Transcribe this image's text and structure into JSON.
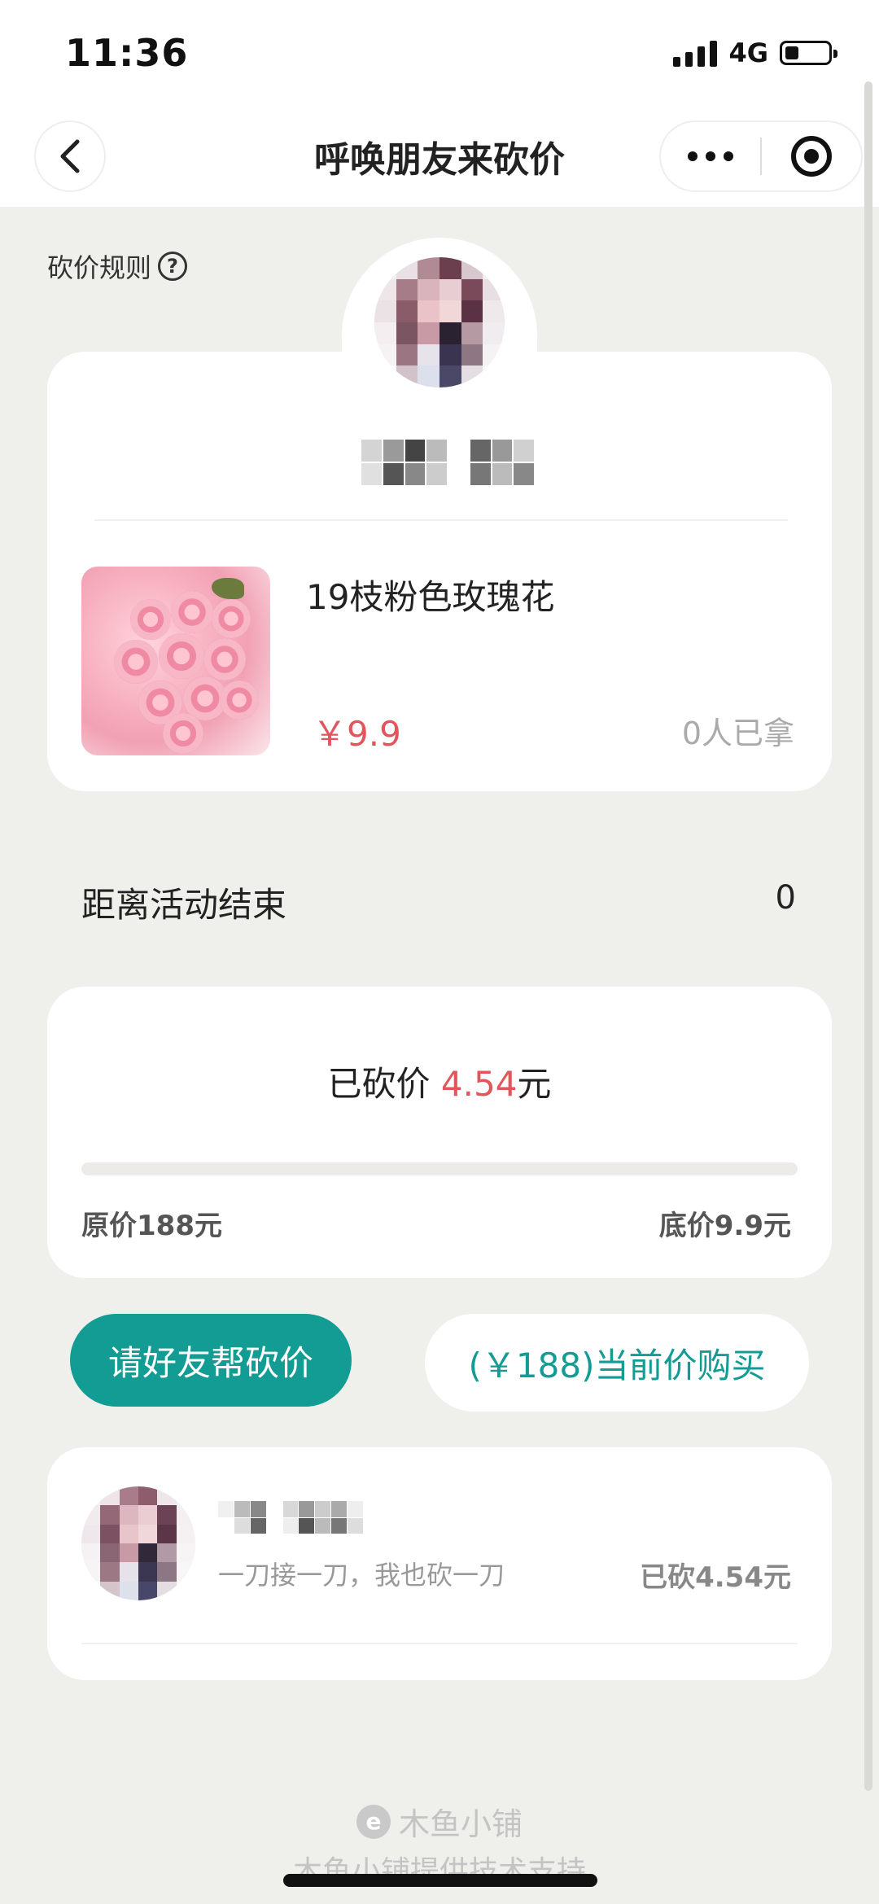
{
  "status_bar": {
    "time": "11:36",
    "network": "4G",
    "battery_level": 0.3
  },
  "nav": {
    "title": "呼唤朋友来砍价",
    "back_icon": "chevron-left-icon",
    "more_icon": "more-dots-icon",
    "close_icon": "target-close-icon"
  },
  "rules": {
    "label": "砍价规则",
    "help_glyph": "?"
  },
  "product": {
    "name": "19枝粉色玫瑰花",
    "price": "￥9.9",
    "taken": "0人已拿"
  },
  "countdown": {
    "label": "距离活动结束",
    "value": "0"
  },
  "bargain": {
    "prefix": "已砍价 ",
    "amount": "4.54",
    "suffix": "元",
    "progress": 0,
    "original_price": "原价188元",
    "floor_price": "底价9.9元"
  },
  "actions": {
    "help_label": "请好友帮砍价",
    "buy_label": "(￥188)当前价购买"
  },
  "friends": [
    {
      "message": "一刀接一刀，我也砍一刀",
      "amount": "已砍4.54元"
    }
  ],
  "footer": {
    "brand": "木鱼小铺",
    "logo_glyph": "e",
    "support": "木鱼小铺提供技术支持"
  },
  "colors": {
    "accent": "#139c94",
    "price_red": "#e2555a",
    "background": "#efefec"
  }
}
